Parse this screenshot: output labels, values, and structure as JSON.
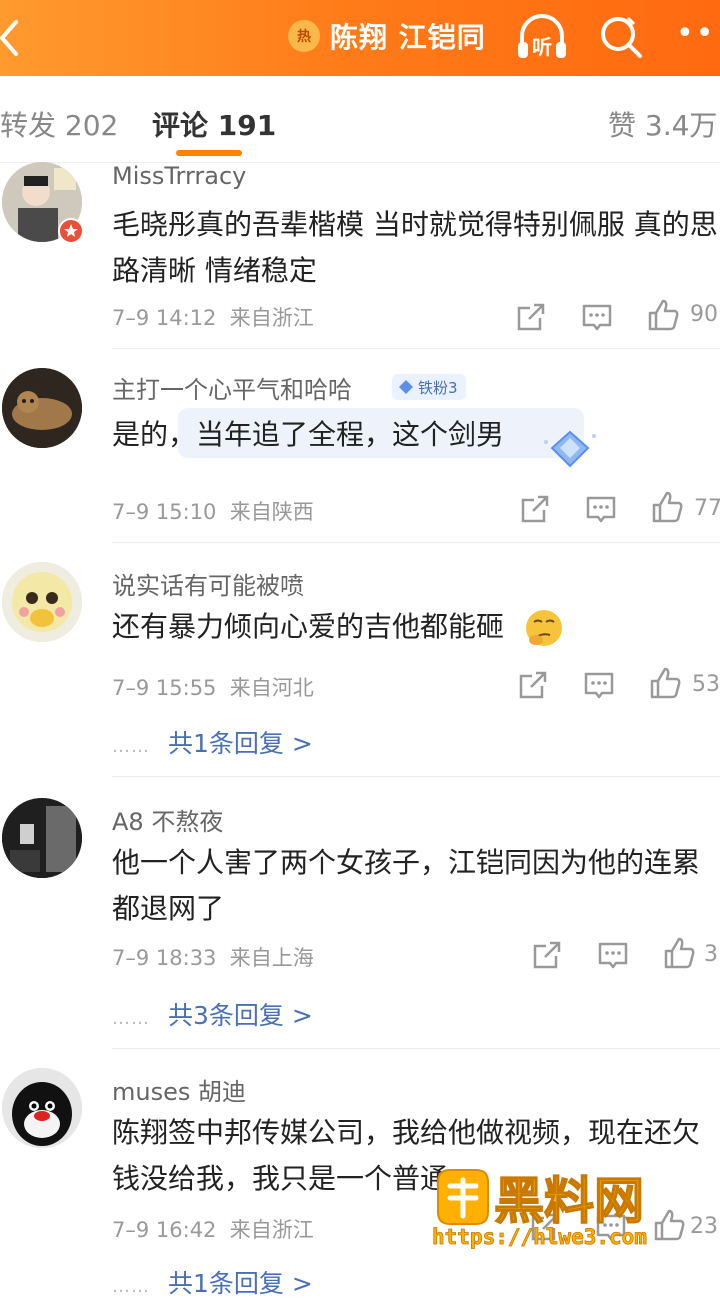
{
  "header": {
    "hot_badge": "热",
    "title": "陈翔 江铠同",
    "listen_label": "听",
    "icons": [
      "back-arrow-icon",
      "headphones-icon",
      "search-icon",
      "more-icon"
    ]
  },
  "tabs": [
    {
      "label": "转发 202"
    },
    {
      "label": "评论 191"
    },
    {
      "label": "赞 3.4万"
    }
  ],
  "colors": {
    "accent": "#ff8200",
    "link": "#4a6fb5",
    "header_bg": "#ff7a18"
  },
  "comments": [
    {
      "user": "MissTrrracy",
      "text": "毛晓彤真的吾辈楷模 当时就觉得特别佩服 真的思路清晰 情绪稳定",
      "time": "7–9 14:12",
      "location": "来自浙江",
      "likes": "90"
    },
    {
      "user": "主打一个心平气和哈哈",
      "badge": "铁粉3",
      "text": "是的，当年追了全程，这个剑男",
      "time": "7–9 15:10",
      "location": "来自陕西",
      "likes": "77"
    },
    {
      "user": "说实话有可能被喷",
      "text": "还有暴力倾向心爱的吉他都能砸",
      "time": "7–9 15:55",
      "location": "来自河北",
      "likes": "53",
      "replies": "共1条回复 >"
    },
    {
      "user": "A8 不熬夜",
      "text": "他一个人害了两个女孩子，江铠同因为他的连累都退网了",
      "time": "7–9 18:33",
      "location": "来自上海",
      "likes": "3",
      "replies": "共3条回复 >"
    },
    {
      "user": "muses 胡迪",
      "text": "陈翔签中邦传媒公司，我给他做视频，现在还欠钱没给我，我只是一个普通",
      "time": "7–9 16:42",
      "location": "来自浙江",
      "likes": "23",
      "replies": "共1条回复 >"
    }
  ],
  "reply_dots": "……",
  "watermark": {
    "brand": "黑料网",
    "url": "https://hlwe3.com"
  }
}
